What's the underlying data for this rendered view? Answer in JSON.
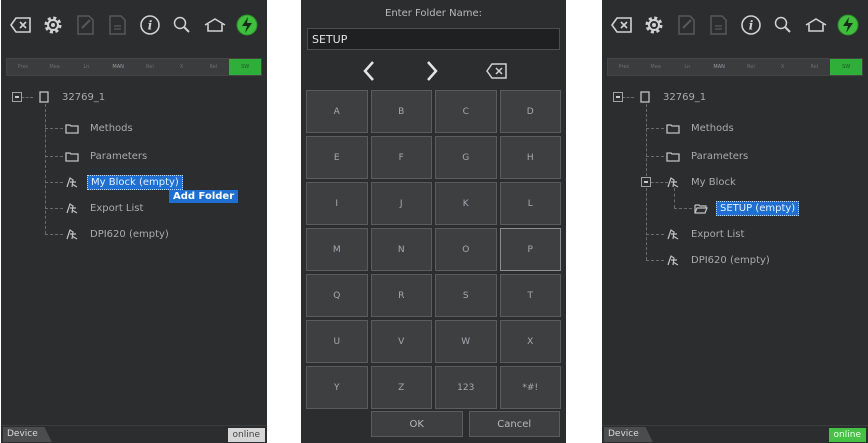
{
  "toolbar_icons": [
    "backspace-icon",
    "gear-icon",
    "edit-document-icon",
    "document-icon",
    "info-icon",
    "zoom-icon",
    "home-icon",
    "power-icon"
  ],
  "strip_labels": [
    "Pres",
    "Mea",
    "Ln",
    "MAN",
    "Rel",
    "X",
    "Rel",
    "SW"
  ],
  "panel1": {
    "root": "32769_1",
    "items": [
      "Methods",
      "Parameters",
      "My Block (empty)",
      "Export List",
      "DPI620 (empty)"
    ],
    "tooltip": "Add Folder",
    "tab": "Device",
    "status": "online"
  },
  "panel2": {
    "title": "Enter Folder Name:",
    "input_value": "SETUP",
    "keys": [
      "A",
      "B",
      "C",
      "D",
      "E",
      "F",
      "G",
      "H",
      "I",
      "J",
      "K",
      "L",
      "M",
      "N",
      "O",
      "P",
      "Q",
      "R",
      "S",
      "T",
      "U",
      "V",
      "W",
      "X",
      "Y",
      "Z",
      "123",
      "*#!"
    ],
    "ok": "OK",
    "cancel": "Cancel"
  },
  "panel3": {
    "root": "32769_1",
    "items": [
      "Methods",
      "Parameters",
      "My Block",
      "SETUP (empty)",
      "Export List",
      "DPI620 (empty)"
    ],
    "tab": "Device",
    "status": "online"
  },
  "colors": {
    "selection": "#1e6fd1",
    "panel_bg": "#2b2d2e",
    "online_green": "#47c046"
  }
}
